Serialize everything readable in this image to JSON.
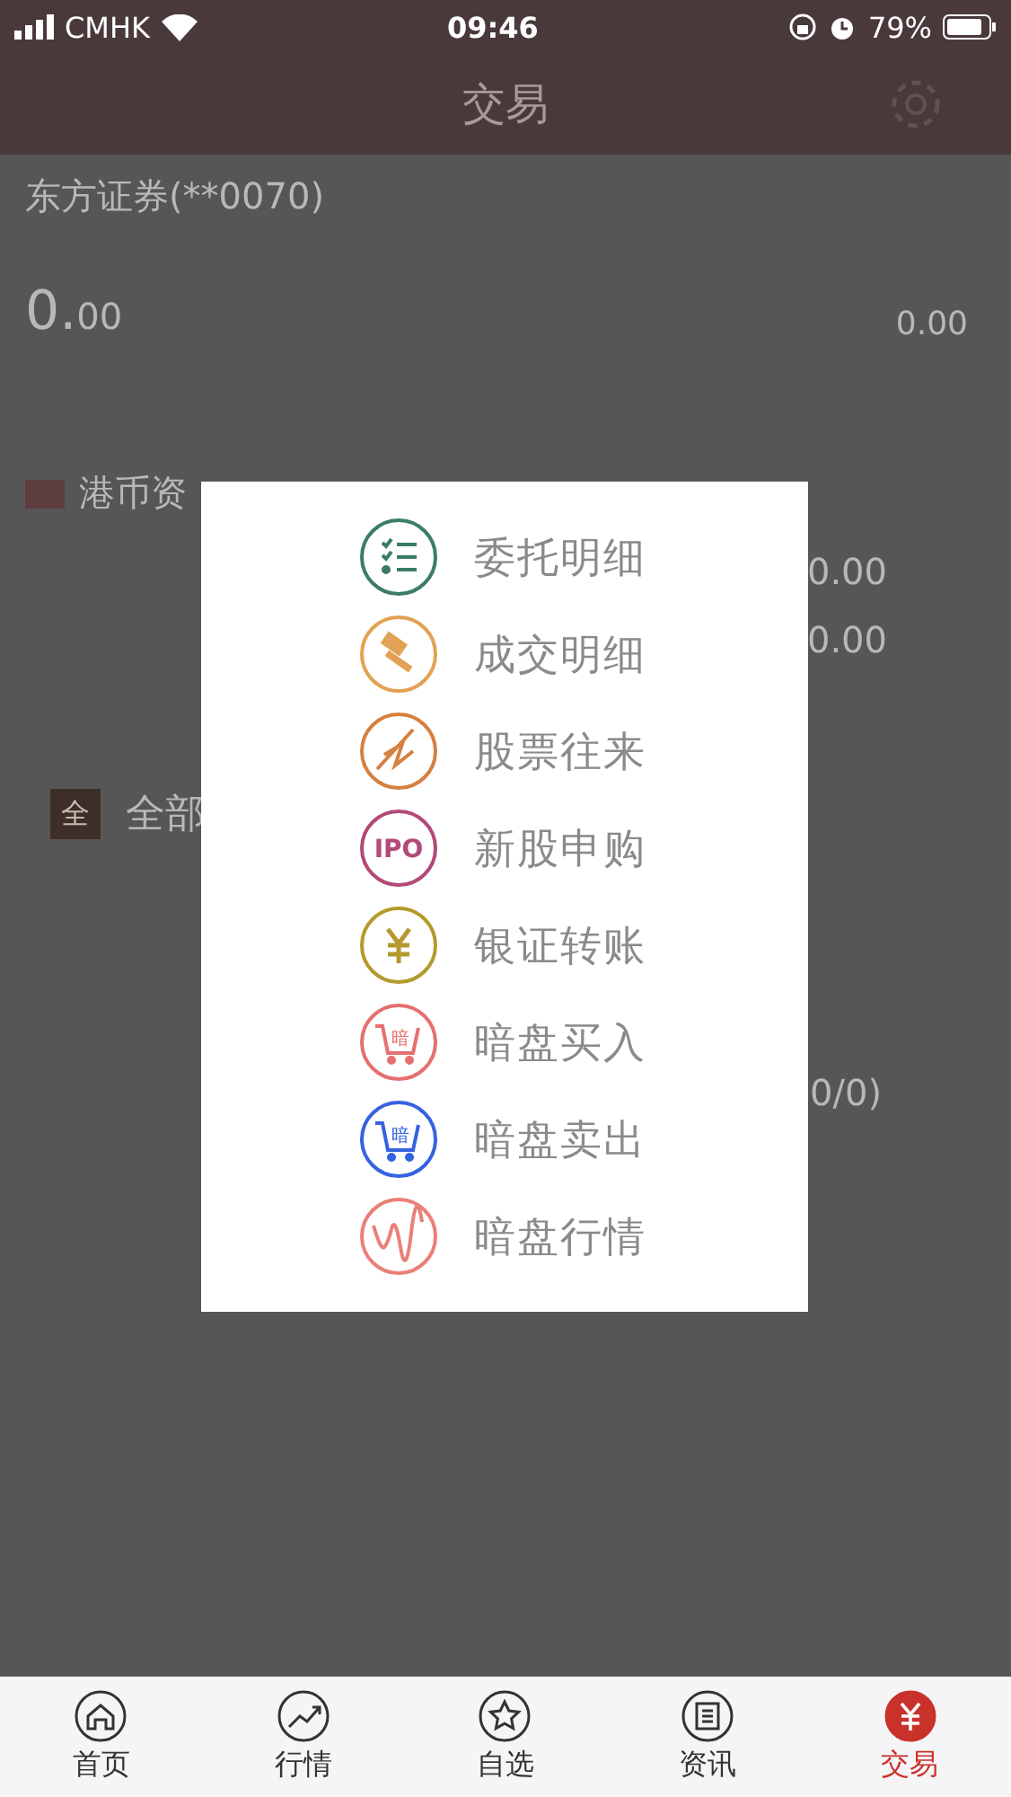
{
  "status_bar": {
    "carrier": "CMHK",
    "time": "09:46",
    "battery": "79%"
  },
  "header": {
    "title": "交易"
  },
  "account": {
    "name": "东方证券(**0070)",
    "integer": "0.",
    "decimal": "00",
    "right_values": [
      "0.00"
    ]
  },
  "currency": {
    "label": "港币资",
    "rows": [
      "0.00",
      "0.00"
    ]
  },
  "all_tab": {
    "badge": "全",
    "label": "全部"
  },
  "orders": {
    "count": "0/0)"
  },
  "menu": [
    {
      "label": "委托明细",
      "kind": "list",
      "color": "#3b7d62"
    },
    {
      "label": "成交明细",
      "kind": "gavel",
      "color": "#e2a253"
    },
    {
      "label": "股票往来",
      "kind": "swap",
      "color": "#d5803f"
    },
    {
      "label": "新股申购",
      "kind": "ipo",
      "color": "#b24a78",
      "icon_text": "IPO"
    },
    {
      "label": "银证转账",
      "kind": "yen",
      "color": "#b49a2c"
    },
    {
      "label": "暗盘买入",
      "kind": "cart",
      "color": "#e57070",
      "icon_text": "暗"
    },
    {
      "label": "暗盘卖出",
      "kind": "cart",
      "color": "#3563e0",
      "icon_text": "暗"
    },
    {
      "label": "暗盘行情",
      "kind": "wave",
      "color": "#ea8078"
    }
  ],
  "tabbar": [
    {
      "label": "首页",
      "kind": "home",
      "selected": false
    },
    {
      "label": "行情",
      "kind": "trend",
      "selected": false
    },
    {
      "label": "自选",
      "kind": "star",
      "selected": false
    },
    {
      "label": "资讯",
      "kind": "news",
      "selected": false
    },
    {
      "label": "交易",
      "kind": "yen",
      "selected": true
    }
  ]
}
